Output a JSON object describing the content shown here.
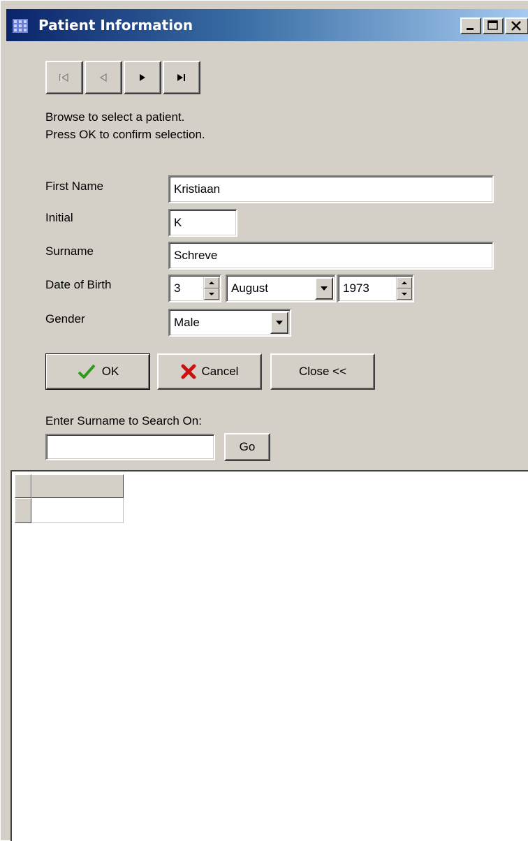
{
  "window": {
    "title": "Patient Information",
    "app_icon": "grid-app-icon",
    "controls": [
      "minimize-icon",
      "maximize-icon",
      "close-icon"
    ]
  },
  "navigator": {
    "buttons": [
      "first-record-icon",
      "prior-record-icon",
      "next-record-icon",
      "last-record-icon"
    ]
  },
  "instructions": {
    "line1": "Browse to select a patient.",
    "line2": "Press OK to confirm selection."
  },
  "form": {
    "first_name_label": "First Name",
    "first_name_value": "Kristiaan",
    "initial_label": "Initial",
    "initial_value": "K",
    "surname_label": "Surname",
    "surname_value": "Schreve",
    "dob_label": "Date of Birth",
    "dob_day": "3",
    "dob_month": "August",
    "dob_year": "1973",
    "gender_label": "Gender",
    "gender_value": "Male"
  },
  "actions": {
    "ok_label": "OK",
    "cancel_label": "Cancel",
    "close_label": "Close <<"
  },
  "search": {
    "label": "Enter Surname to Search On:",
    "value": "",
    "go_label": "Go"
  },
  "colors": {
    "face": "#d4d0c8",
    "title_start": "#0a246a",
    "title_end": "#a6caf0",
    "ok_check": "#2e9b1e",
    "cancel_x": "#cc1010"
  }
}
